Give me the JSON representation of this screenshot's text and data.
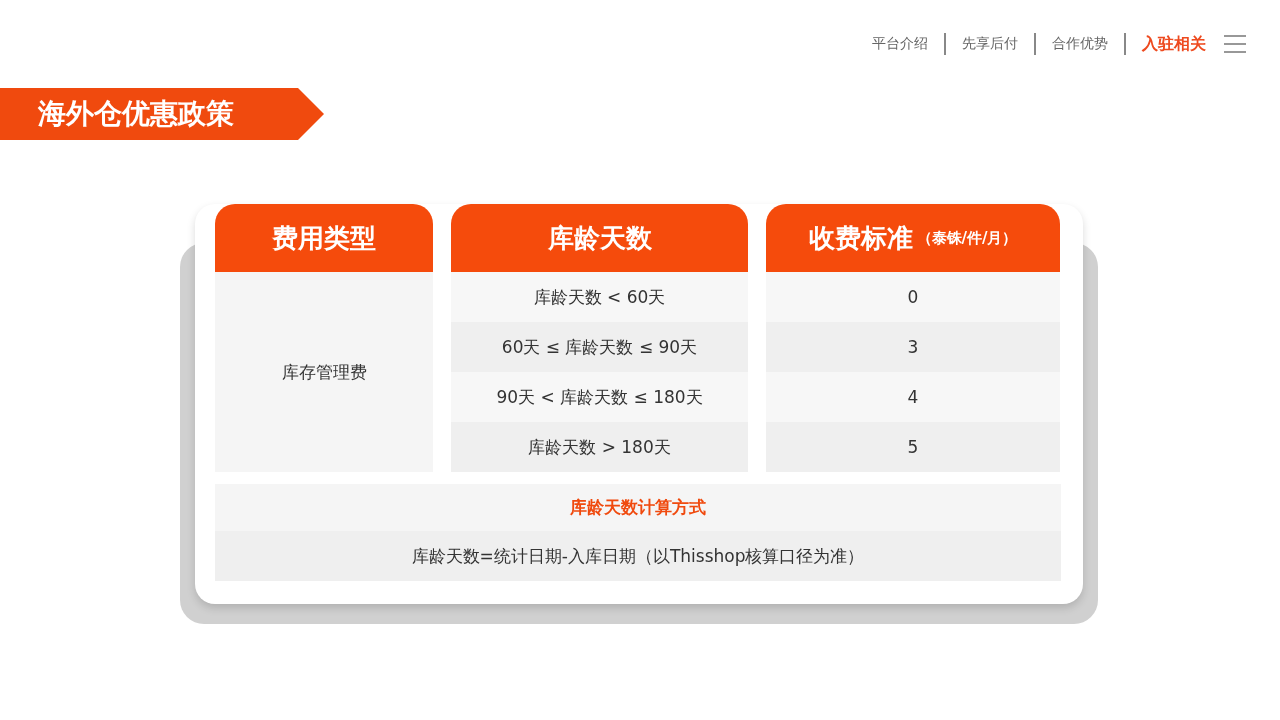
{
  "nav": {
    "items": [
      {
        "label": "平台介绍",
        "selected": false
      },
      {
        "label": "先享后付",
        "selected": false
      },
      {
        "label": "合作优势",
        "selected": false
      },
      {
        "label": "入驻相关",
        "selected": true
      }
    ]
  },
  "banner": {
    "title": "海外仓优惠政策"
  },
  "table": {
    "columns": [
      {
        "label": "费用类型"
      },
      {
        "label": "库龄天数"
      },
      {
        "label": "收费标准",
        "note": "（泰铢/件/月）"
      }
    ],
    "fee_type": "库存管理费",
    "rows": [
      {
        "age": "库龄天数 < 60天",
        "fee": "0"
      },
      {
        "age": "60天 ≤ 库龄天数 ≤ 90天",
        "fee": "3"
      },
      {
        "age": "90天 < 库龄天数 ≤ 180天",
        "fee": "4"
      },
      {
        "age": "库龄天数 > 180天",
        "fee": "5"
      }
    ],
    "calc_title": "库龄天数计算方式",
    "calc_formula": "库龄天数=统计日期-入库日期（以Thisshop核算口径为准）"
  }
}
